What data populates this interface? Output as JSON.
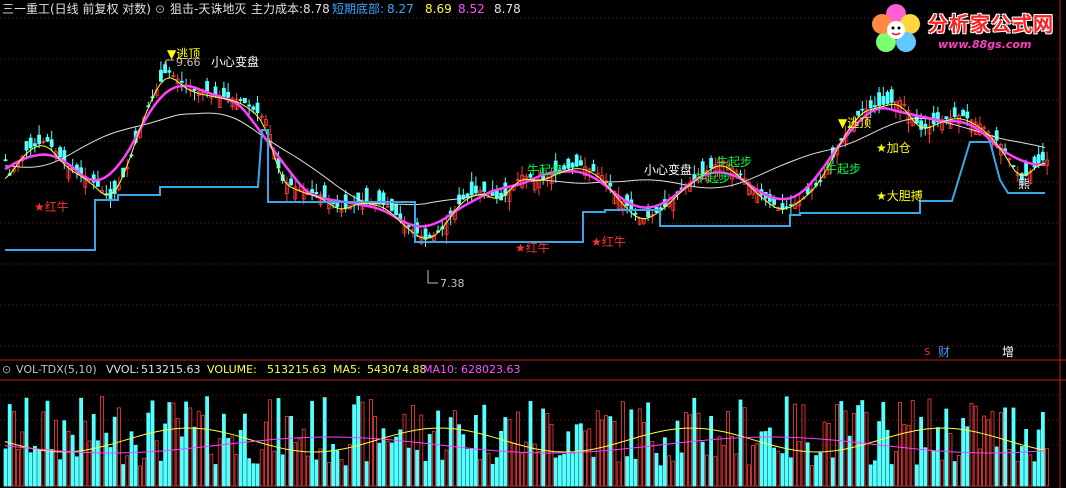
{
  "header": {
    "stock_name": "三一重工(日线 前复权 对数)",
    "indicator_name": "狙击-天诛地灭",
    "main_cost_label": "主力成本:",
    "main_cost_value": "8.78",
    "short_bottom_label": "短期底部:",
    "v1": "8.27",
    "v2": "8.69",
    "v3": "8.52",
    "v4": "8.78"
  },
  "logo": {
    "title": "分析家公式网",
    "url": "www.88gs.com"
  },
  "annotations": {
    "taopiao_1": "▼逃顶",
    "high_price": "9.66",
    "xiaoxin_1": "小心变盘",
    "hongniu_1": "★红牛",
    "low_price": "7.38",
    "hongniu_2": "★红牛",
    "hongniu_3": "★红牛",
    "niuqibu_1": "牛起步",
    "xiaoxin_2": "小心变盘",
    "niuqibu_2": "牛起步",
    "niuqibu_3": "牛起步",
    "taopiao_2": "▼逃顶",
    "jiacang": "★加仓",
    "niuqibu_4": "牛起步",
    "dadanbo": "★大胆搏",
    "xiong": "熊",
    "marker_s": "S",
    "marker_cai": "财",
    "marker_zeng": "增"
  },
  "volume_panel": {
    "indicator": "VOL-TDX(5,10)",
    "vvol_label": "VVOL:",
    "vvol_value": "513215.63",
    "volume_label": "VOLUME:",
    "volume_value": "513215.63",
    "ma5_label": "MA5:",
    "ma5_value": "543074.88",
    "ma10_label": "MA10:",
    "ma10_value": "628023.63"
  },
  "colors": {
    "up": "#ff3b3b",
    "down": "#54ffff",
    "ma_magenta": "#ff40ff",
    "ma_white": "#e0e0e0",
    "ma_yellow": "#ffff40",
    "support_blue": "#3aa8e8",
    "grid": "#8b1010",
    "label_white": "#ffffff",
    "label_yellow": "#ffff00",
    "label_red": "#ff3030",
    "label_green": "#00ff40",
    "label_blue": "#4090ff",
    "label_mag": "#ff50ff"
  }
}
